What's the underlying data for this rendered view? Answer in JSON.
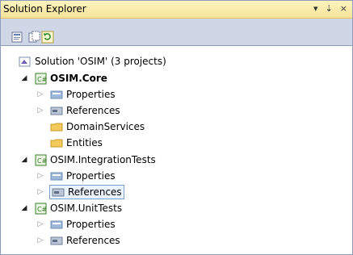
{
  "window": {
    "title": "Solution Explorer",
    "pin_glyph": "⇣",
    "close_glyph": "×",
    "dropdown_glyph": "▾"
  },
  "toolbar": {
    "buttons": [
      {
        "name": "properties-icon"
      },
      {
        "name": "show-all-files-icon"
      },
      {
        "name": "refresh-icon"
      }
    ]
  },
  "tree": {
    "solution": "Solution 'OSIM' (3 projects)",
    "projects": [
      {
        "name": "OSIM.Core",
        "bold": true,
        "children": [
          "Properties",
          "References",
          "DomainServices",
          "Entities"
        ]
      },
      {
        "name": "OSIM.IntegrationTests",
        "bold": false,
        "children": [
          "Properties",
          "References"
        ]
      },
      {
        "name": "OSIM.UnitTests",
        "bold": false,
        "children": [
          "Properties",
          "References"
        ]
      }
    ]
  },
  "colors": {
    "titlebar": "#f6e39a",
    "toolbar": "#cfd6e5",
    "selection_border": "#7da2ce",
    "csharp_icon": "#3a7d2b",
    "folder": "#f2c95a"
  }
}
